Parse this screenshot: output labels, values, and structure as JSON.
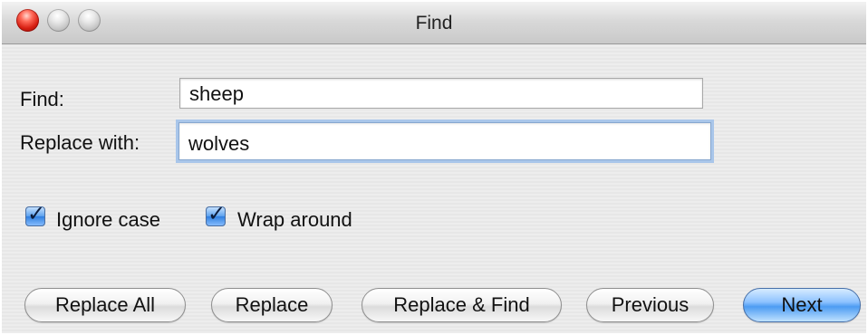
{
  "window": {
    "title": "Find"
  },
  "form": {
    "find_label": "Find:",
    "find_value": "sheep",
    "replace_label": "Replace with:",
    "replace_value": "wolves"
  },
  "options": {
    "ignore_case_label": "Ignore case",
    "ignore_case_checked": true,
    "wrap_around_label": "Wrap around",
    "wrap_around_checked": true
  },
  "buttons": {
    "replace_all": "Replace All",
    "replace": "Replace",
    "replace_and_find": "Replace & Find",
    "previous": "Previous",
    "next": "Next"
  },
  "icons": {
    "close": "close-icon",
    "minimize": "minimize-icon",
    "zoom": "zoom-icon",
    "checkmark": "checkmark-icon"
  },
  "colors": {
    "default_button_accent": "#4d9cf2",
    "close_button_red": "#d71f12",
    "focus_ring": "#a9c6ea"
  }
}
